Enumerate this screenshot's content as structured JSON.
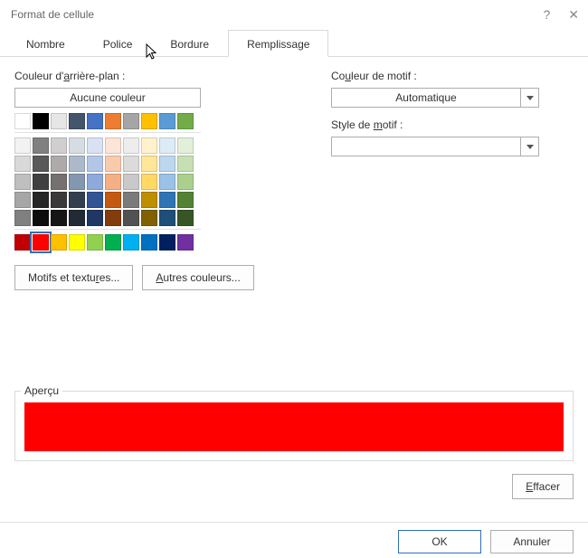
{
  "window": {
    "title": "Format de cellule",
    "help": "?",
    "close": "✕"
  },
  "tabs": {
    "nombre": "Nombre",
    "police": "Police",
    "bordure": "Bordure",
    "remplissage": "Remplissage"
  },
  "bg": {
    "label_prefix": "Couleur d'",
    "label_u": "a",
    "label_suffix": "rrière-plan :",
    "no_color": "Aucune couleur"
  },
  "pattern_color": {
    "label_prefix": "Co",
    "label_u": "u",
    "label_suffix": "leur de motif :",
    "value": "Automatique"
  },
  "pattern_style": {
    "label_prefix": "Style de ",
    "label_u": "m",
    "label_suffix": "otif :",
    "value": ""
  },
  "buttons": {
    "fill_effects_prefix": "Motifs et textu",
    "fill_effects_u": "r",
    "fill_effects_suffix": "es...",
    "more_colors_u": "A",
    "more_colors_suffix": "utres couleurs...",
    "clear_u": "E",
    "clear_suffix": "ffacer",
    "ok": "OK",
    "cancel": "Annuler"
  },
  "preview": {
    "label": "Aperçu",
    "color": "#ff0000"
  },
  "palette": {
    "row1": [
      "#ffffff",
      "#000000",
      "#e7e6e6",
      "#44546a",
      "#4472c4",
      "#ed7d31",
      "#a5a5a5",
      "#ffc000",
      "#5b9bd5",
      "#70ad47"
    ],
    "theme": [
      [
        "#f2f2f2",
        "#808080",
        "#d0cece",
        "#d6dce4",
        "#d9e1f2",
        "#fce4d6",
        "#ededed",
        "#fff2cc",
        "#ddebf7",
        "#e2efda"
      ],
      [
        "#d9d9d9",
        "#595959",
        "#aeaaaa",
        "#acb9ca",
        "#b4c6e7",
        "#f8cbad",
        "#dbdbdb",
        "#ffe699",
        "#bdd7ee",
        "#c6e0b4"
      ],
      [
        "#bfbfbf",
        "#404040",
        "#757171",
        "#8497b0",
        "#8ea9db",
        "#f4b084",
        "#c9c9c9",
        "#ffd966",
        "#9bc2e6",
        "#a9d08e"
      ],
      [
        "#a6a6a6",
        "#262626",
        "#3a3838",
        "#333f4f",
        "#305496",
        "#c65911",
        "#7b7b7b",
        "#bf8f00",
        "#2f75b5",
        "#548235"
      ],
      [
        "#808080",
        "#0d0d0d",
        "#161616",
        "#222b35",
        "#203764",
        "#833c0c",
        "#525252",
        "#806000",
        "#1f4e78",
        "#375623"
      ]
    ],
    "standard": [
      "#c00000",
      "#ff0000",
      "#ffc000",
      "#ffff00",
      "#92d050",
      "#00b050",
      "#00b0f0",
      "#0070c0",
      "#002060",
      "#7030a0"
    ],
    "selected_index": 1
  }
}
